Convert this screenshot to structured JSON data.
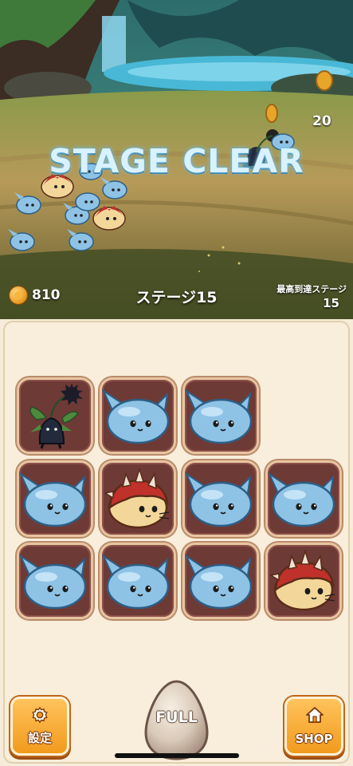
{
  "battle": {
    "banner": "STAGE CLEAR",
    "damage_popup": "20"
  },
  "hud": {
    "coins": "810",
    "current_stage": "ステージ15",
    "best_stage_label": "最高到達ステージ",
    "best_stage_value": "15"
  },
  "board": {
    "rows": [
      [
        "sprout",
        "blue-slime",
        "blue-slime",
        "empty"
      ],
      [
        "blue-slime",
        "red-spiky-slime",
        "blue-slime",
        "blue-slime"
      ],
      [
        "blue-slime",
        "blue-slime",
        "blue-slime",
        "red-spiky-slime"
      ]
    ]
  },
  "controls": {
    "settings_label": "設定",
    "summon_label": "FULL",
    "shop_label": "SHOP"
  },
  "colors": {
    "slot_bg": "#6e3a36",
    "board_bg": "#f8eedb",
    "button_orange": "#f29a1d",
    "blue_slime": "#8fc3e6",
    "red_slime": "#c0312b"
  }
}
